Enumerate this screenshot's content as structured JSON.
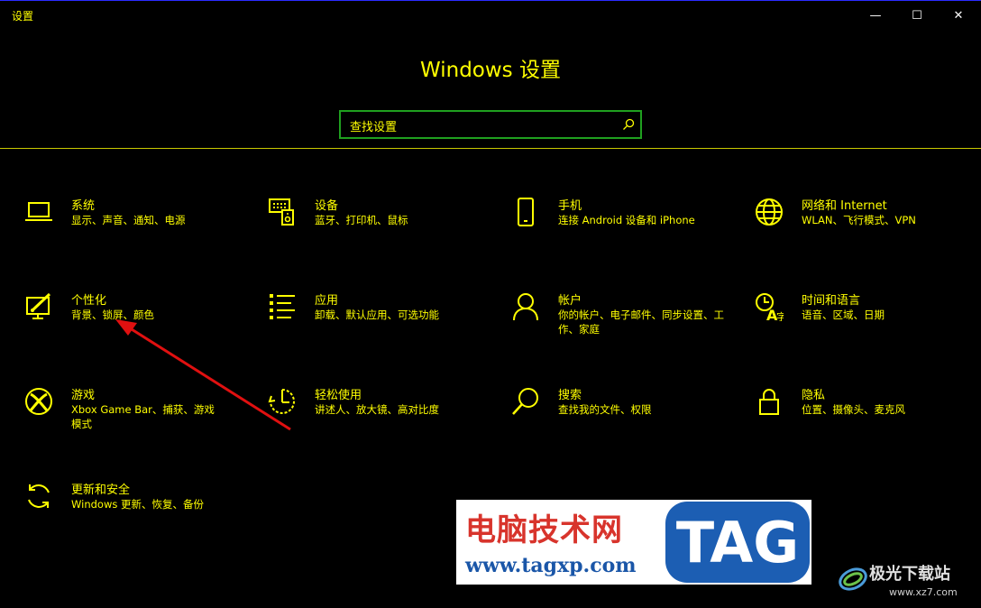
{
  "window": {
    "title": "设置",
    "minimize_glyph": "—",
    "maximize_glyph": "☐",
    "close_glyph": "✕"
  },
  "heading": "Windows 设置",
  "search": {
    "placeholder": "查找设置"
  },
  "tiles": [
    {
      "title": "系统",
      "desc": "显示、声音、通知、电源",
      "icon": "laptop-icon"
    },
    {
      "title": "设备",
      "desc": "蓝牙、打印机、鼠标",
      "icon": "devices-icon"
    },
    {
      "title": "手机",
      "desc": "连接 Android 设备和 iPhone",
      "icon": "phone-icon"
    },
    {
      "title": "网络和 Internet",
      "desc": "WLAN、飞行模式、VPN",
      "icon": "globe-icon"
    },
    {
      "title": "个性化",
      "desc": "背景、锁屏、颜色",
      "icon": "personalization-icon"
    },
    {
      "title": "应用",
      "desc": "卸载、默认应用、可选功能",
      "icon": "apps-list-icon"
    },
    {
      "title": "帐户",
      "desc": "你的帐户、电子邮件、同步设置、工作、家庭",
      "icon": "person-icon"
    },
    {
      "title": "时间和语言",
      "desc": "语音、区域、日期",
      "icon": "time-language-icon"
    },
    {
      "title": "游戏",
      "desc": "Xbox Game Bar、捕获、游戏模式",
      "icon": "xbox-icon"
    },
    {
      "title": "轻松使用",
      "desc": "讲述人、放大镜、高对比度",
      "icon": "ease-of-access-icon"
    },
    {
      "title": "搜索",
      "desc": "查找我的文件、权限",
      "icon": "search-icon"
    },
    {
      "title": "隐私",
      "desc": "位置、摄像头、麦克风",
      "icon": "lock-icon"
    },
    {
      "title": "更新和安全",
      "desc": "Windows 更新、恢复、备份",
      "icon": "update-icon"
    }
  ],
  "watermark": {
    "brand_cn": "电脑技术网",
    "url": "www.tagxp.com",
    "tag": "TAG"
  },
  "site_badge": {
    "name": "极光下载站",
    "url": "www.xz7.com"
  },
  "colors": {
    "background": "#000000",
    "text": "#ffff00",
    "search_border": "#1fa01f",
    "annotation_arrow": "#e01010"
  }
}
